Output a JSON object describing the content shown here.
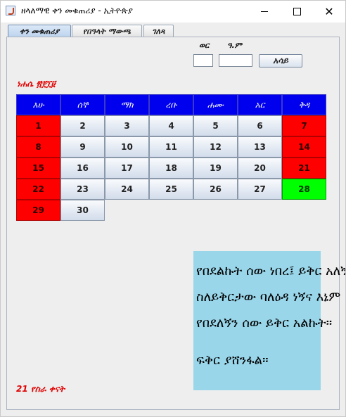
{
  "window": {
    "title": "ዘላለማዊ ቀን መቁጠሪያ - ኢትዮጵያ",
    "minimize_glyph": "",
    "close_glyph": "✕"
  },
  "tabs": [
    {
      "label": "ቀን መቁጠሪያ",
      "active": true
    },
    {
      "label": "የበዓላት ማውጫ",
      "active": false
    },
    {
      "label": "ገለጻ",
      "active": false
    }
  ],
  "controls": {
    "month_label": "ወር",
    "year_label": "ዓ.ም",
    "month_value": "",
    "year_value": "",
    "show_button": "አሳይ"
  },
  "calendar": {
    "month_title": "ነሐሴ ፳፻፲፱",
    "weekdays": [
      "እሁ",
      "ሰኞ",
      "ማክ",
      "ረቡ",
      "ሐሙ",
      "አር",
      "ቅዳ"
    ],
    "rows": [
      [
        "1",
        "2",
        "3",
        "4",
        "5",
        "6",
        "7"
      ],
      [
        "8",
        "9",
        "10",
        "11",
        "12",
        "13",
        "14"
      ],
      [
        "15",
        "16",
        "17",
        "18",
        "19",
        "20",
        "21"
      ],
      [
        "22",
        "23",
        "24",
        "25",
        "26",
        "27",
        "28"
      ],
      [
        "29",
        "30",
        "",
        "",
        "",
        "",
        ""
      ]
    ],
    "colors": {
      "header": "#0000ee",
      "holiday": "#ff0000",
      "today": "#00ff00",
      "weekday": "#dbe4ef"
    }
  },
  "quote": {
    "line1": "የበደልኩት ሰው ነበረ፤ ይቅር አለኝ።",
    "line2": "ስለይቅርታው ባለዕዳ ነኝና እኔም",
    "line3": "የበደለኝን ሰው ይቅር አልኩት።",
    "line4": "ፍቅር ያሸንፋል።"
  },
  "status": {
    "work_days": "21 የስራ ቀናት"
  }
}
